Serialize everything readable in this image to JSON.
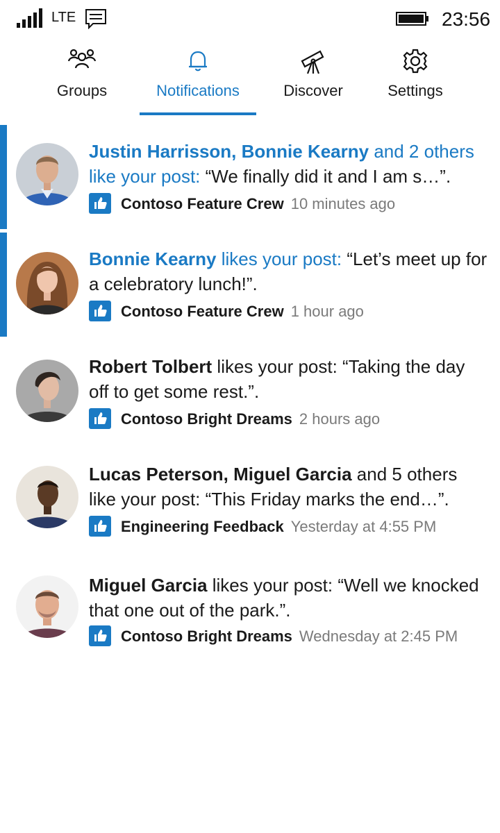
{
  "status": {
    "network": "LTE",
    "time": "23:56"
  },
  "nav": {
    "tabs": [
      {
        "label": "Groups",
        "icon": "people-icon"
      },
      {
        "label": "Notifications",
        "icon": "bell-icon",
        "active": true
      },
      {
        "label": "Discover",
        "icon": "telescope-icon"
      },
      {
        "label": "Settings",
        "icon": "gear-icon"
      }
    ]
  },
  "colors": {
    "accent": "#1a7ac4",
    "muted": "#7a7a7a"
  },
  "notifications": [
    {
      "names": "Justin Harrisson, Bonnie Kearny",
      "verb": " and 2 others like your post: ",
      "quote": "“We finally did it and I am s…”.",
      "group": "Contoso Feature Crew",
      "time": "10 minutes ago",
      "unread": true
    },
    {
      "names": "Bonnie Kearny",
      "verb": " likes your post: ",
      "quote": "“Let’s meet up for a celebratory lunch!”.",
      "group": "Contoso Feature Crew",
      "time": "1 hour ago",
      "unread": true
    },
    {
      "names": "Robert Tolbert",
      "verb": " likes your post: ",
      "quote": "“Taking the day off to get some rest.”.",
      "group": "Contoso Bright Dreams",
      "time": "2 hours ago",
      "unread": false
    },
    {
      "names": "Lucas Peterson, Miguel Garcia",
      "verb": " and 5 others like your post: ",
      "quote": "“This Friday marks the end…”.",
      "group": "Engineering Feedback",
      "time": "Yesterday at 4:55 PM",
      "unread": false
    },
    {
      "names": "Miguel Garcia",
      "verb": " likes your post: ",
      "quote": "“Well we knocked that one out of the park.”.",
      "group": "Contoso Bright Dreams",
      "time": "Wednesday at 2:45 PM",
      "unread": false
    }
  ]
}
